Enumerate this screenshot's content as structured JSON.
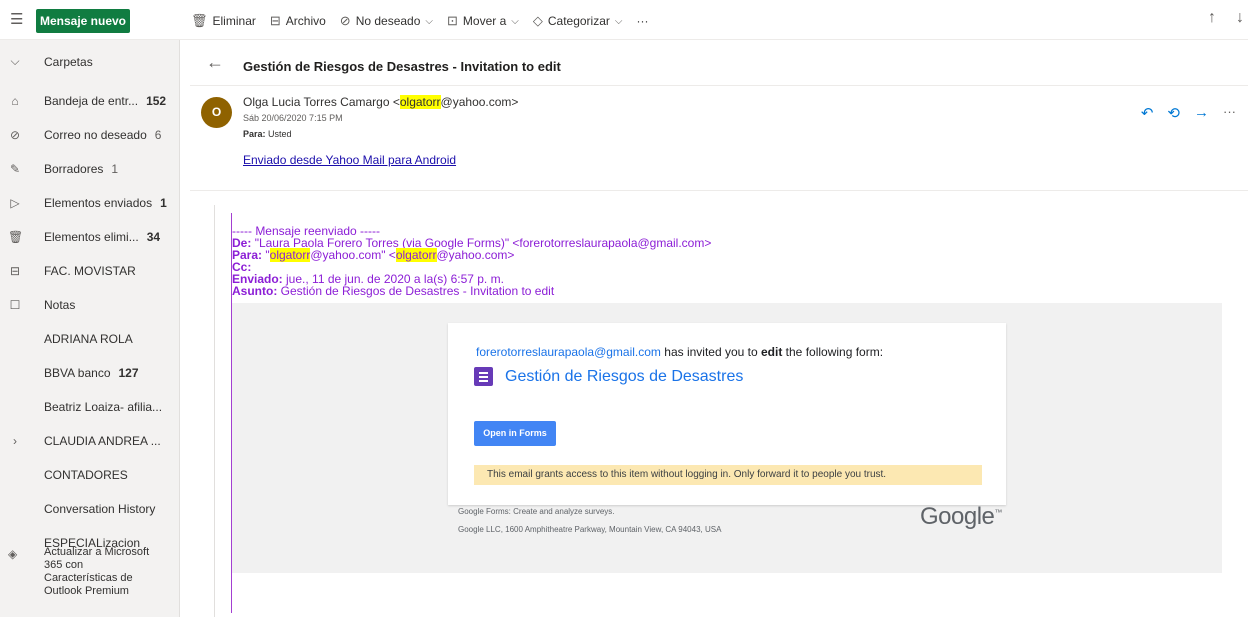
{
  "topbar": {
    "new_message": "Mensaje nuevo",
    "toolbar": [
      {
        "icon": "trash-icon",
        "glyph": "🗑",
        "label": "Eliminar",
        "chevron": false
      },
      {
        "icon": "archive-icon",
        "glyph": "⊟",
        "label": "Archivo",
        "chevron": false
      },
      {
        "icon": "block-icon",
        "glyph": "⊘",
        "label": "No deseado",
        "chevron": true
      },
      {
        "icon": "move-icon",
        "glyph": "⊡",
        "label": "Mover a",
        "chevron": true
      },
      {
        "icon": "tag-icon",
        "glyph": "◇",
        "label": "Categorizar",
        "chevron": true
      }
    ],
    "more": "···"
  },
  "sidebar": {
    "header": "Carpetas",
    "items": [
      {
        "name": "inbox",
        "icon": "inbox-icon",
        "glyph": "⌂",
        "label": "Bandeja de entr...",
        "count": "152",
        "bold": true
      },
      {
        "name": "junk",
        "icon": "block-icon",
        "glyph": "⊘",
        "label": "Correo no deseado",
        "count": "6",
        "bold": false
      },
      {
        "name": "drafts",
        "icon": "pencil-icon",
        "glyph": "✎",
        "label": "Borradores",
        "count": "1",
        "bold": false
      },
      {
        "name": "sent",
        "icon": "send-icon",
        "glyph": "▷",
        "label": "Elementos enviados",
        "count": "1",
        "bold": true
      },
      {
        "name": "deleted",
        "icon": "trash-icon",
        "glyph": "🗑",
        "label": "Elementos elimi...",
        "count": "34",
        "bold": true
      },
      {
        "name": "fac-movistar",
        "icon": "archive-icon",
        "glyph": "⊟",
        "label": "FAC. MOVISTAR",
        "count": "",
        "bold": false
      },
      {
        "name": "notas",
        "icon": "note-icon",
        "glyph": "☐",
        "label": "Notas",
        "count": "",
        "bold": false
      },
      {
        "name": "adriana-rola",
        "icon": "",
        "glyph": "",
        "label": "ADRIANA ROLA",
        "count": "",
        "bold": false
      },
      {
        "name": "bbva-banco",
        "icon": "",
        "glyph": "",
        "label": "BBVA banco",
        "count": "127",
        "bold": true
      },
      {
        "name": "beatriz-loaiza",
        "icon": "",
        "glyph": "",
        "label": "Beatriz Loaiza- afilia...",
        "count": "",
        "bold": false
      },
      {
        "name": "claudia-andrea",
        "icon": "chevron-right-icon",
        "glyph": "›",
        "label": "CLAUDIA ANDREA ...",
        "count": "",
        "bold": false
      },
      {
        "name": "contadores",
        "icon": "",
        "glyph": "",
        "label": "CONTADORES",
        "count": "",
        "bold": false
      },
      {
        "name": "conversation-history",
        "icon": "",
        "glyph": "",
        "label": "Conversation History",
        "count": "",
        "bold": false
      },
      {
        "name": "especializacion",
        "icon": "",
        "glyph": "",
        "label": "ESPECIALizacion",
        "count": "",
        "bold": false
      }
    ],
    "upgrade": [
      "Actualizar a Microsoft",
      "365 con",
      "Características de",
      "Outlook Premium"
    ]
  },
  "message": {
    "subject": "Gestión de Riesgos de Desastres - Invitation to edit",
    "avatar_letter": "O",
    "sender_name": "Olga Lucia Torres Camargo <",
    "sender_highlight": "olgatorr",
    "sender_domain": "@yahoo.com>",
    "date": "Sáb 20/06/2020 7:15 PM",
    "to_label": "Para:",
    "to_value": "Usted",
    "sent_from": "Enviado desde Yahoo Mail para Android",
    "forward": {
      "separator": "----- Mensaje reenviado -----",
      "from_label": "De:",
      "from_value": "\"Laura Paola Forero Torres (via Google Forms)\" <forerotorreslaurapaola@gmail.com>",
      "to_label": "Para:",
      "to_q1": "\"",
      "to_hl1": "olgatorr",
      "to_mid": "@yahoo.com\" <",
      "to_hl2": "olgatorr",
      "to_end": "@yahoo.com>",
      "cc_label": "Cc:",
      "sent_label": "Enviado:",
      "sent_value": "jue., 11 de jun. de 2020 a la(s) 6:57 p. m.",
      "subject_label": "Asunto:",
      "subject_value": "Gestión de Riesgos de Desastres  - Invitation to edit"
    },
    "card": {
      "inviter_email": "forerotorreslaurapaola@gmail.com",
      "invite_pre": " has invited you to ",
      "invite_bold": "edit",
      "invite_post": " the following form:",
      "form_title": "Gestión de Riesgos de Desastres",
      "open_button": "Open in Forms",
      "warning": "This email grants access to this item without logging in. Only forward it to people you trust."
    },
    "footer_line1": "Google Forms: Create and analyze surveys.",
    "footer_line2": "Google LLC, 1600 Amphitheatre Parkway, Mountain View, CA 94043, USA",
    "google_logo": "Google"
  },
  "colors": {
    "brand_green": "#107c41",
    "accent_blue": "#0078d4",
    "forward_purple": "#8c1ed6",
    "forms_purple": "#673ab7",
    "highlight": "#ffff00"
  }
}
